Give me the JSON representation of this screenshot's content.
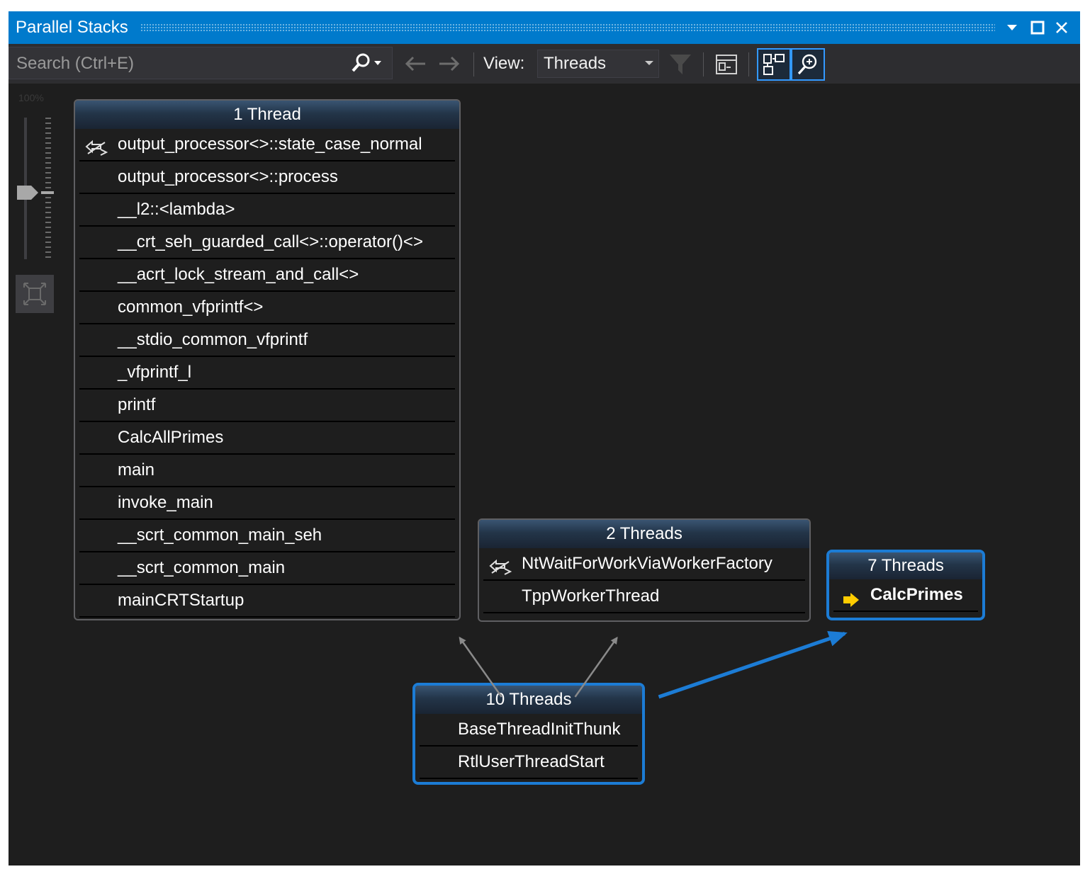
{
  "window": {
    "title": "Parallel Stacks"
  },
  "toolbar": {
    "search_placeholder": "Search (Ctrl+E)",
    "view_label": "View:",
    "view_value": "Threads"
  },
  "zoom": {
    "level": "100%"
  },
  "nodes": {
    "main_thread": {
      "header": "1 Thread",
      "frames": [
        "output_processor<>::state_case_normal",
        "output_processor<>::process",
        "__l2::<lambda>",
        "__crt_seh_guarded_call<>::operator()<>",
        "__acrt_lock_stream_and_call<>",
        "common_vfprintf<>",
        "__stdio_common_vfprintf",
        "_vfprintf_l",
        "printf",
        "CalcAllPrimes",
        "main",
        "invoke_main",
        "__scrt_common_main_seh",
        "__scrt_common_main",
        "mainCRTStartup"
      ]
    },
    "worker_threads": {
      "header": "2 Threads",
      "frames": [
        "NtWaitForWorkViaWorkerFactory",
        "TppWorkerThread"
      ]
    },
    "calc_threads": {
      "header": "7 Threads",
      "frames": [
        "CalcPrimes"
      ]
    },
    "root_threads": {
      "header": "10 Threads",
      "frames": [
        "BaseThreadInitThunk",
        "RtlUserThreadStart"
      ]
    }
  },
  "icons": {
    "frame_thread_switch": "thread-switch-icon",
    "current_frame": "current-frame-arrow-icon"
  },
  "colors": {
    "title_bar": "#007acc",
    "selection_border": "#1c7cd5",
    "current_arrow": "#ffcc00",
    "background": "#1e1e1e"
  }
}
